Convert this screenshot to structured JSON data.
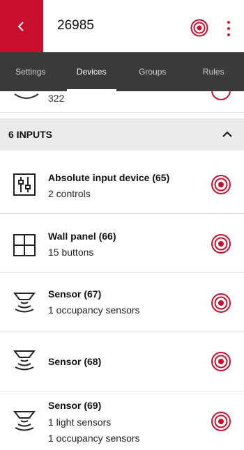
{
  "header": {
    "back_icon": "chevron-left-icon",
    "title": "26985",
    "locate_icon": "target-icon",
    "more_icon": "vertical-dots-icon",
    "accent": "#c8102e"
  },
  "tabs": [
    {
      "label": "Settings",
      "active": false
    },
    {
      "label": "Devices",
      "active": true
    },
    {
      "label": "Groups",
      "active": false
    },
    {
      "label": "Rules",
      "active": false
    }
  ],
  "partial_row": {
    "label": "322"
  },
  "section": {
    "title": "6 INPUTS",
    "chevron_icon": "chevron-up-icon"
  },
  "devices": [
    {
      "name": "Absolute input device (65)",
      "details": [
        "2 controls"
      ],
      "icon": "slider-control-icon"
    },
    {
      "name": "Wall panel (66)",
      "details": [
        "15 buttons"
      ],
      "icon": "wall-panel-icon"
    },
    {
      "name": "Sensor (67)",
      "details": [
        "1 occupancy sensors"
      ],
      "icon": "ceiling-sensor-icon"
    },
    {
      "name": "Sensor (68)",
      "details": [],
      "icon": "ceiling-sensor-icon"
    },
    {
      "name": "Sensor (69)",
      "details": [
        "1 light sensors",
        "1 occupancy sensors"
      ],
      "icon": "ceiling-sensor-icon"
    }
  ]
}
